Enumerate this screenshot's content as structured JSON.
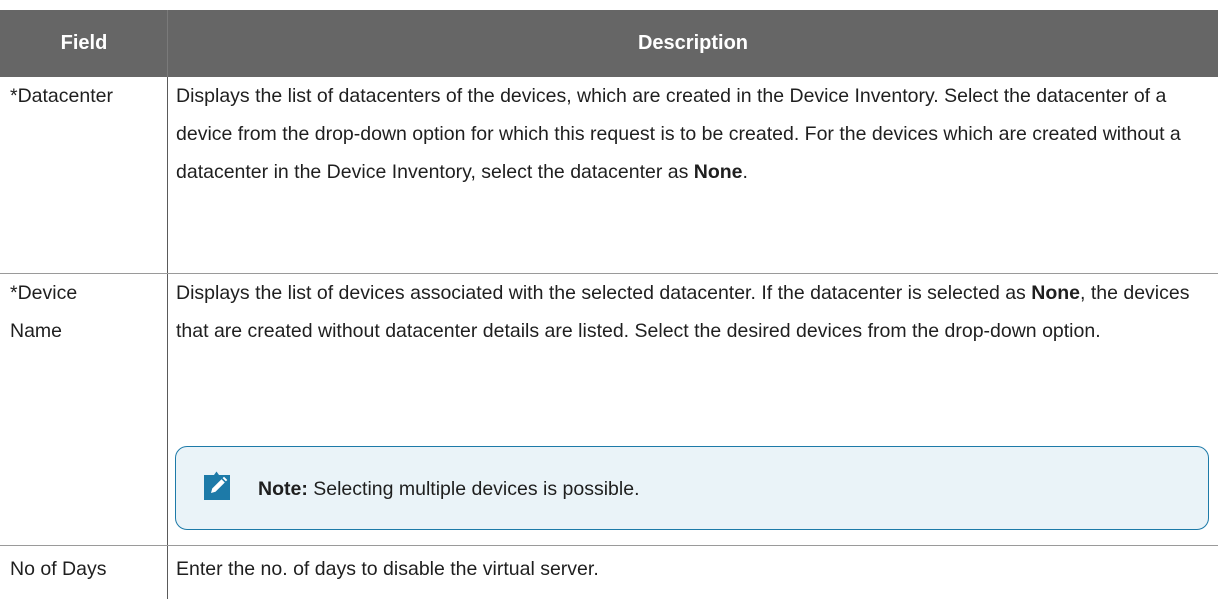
{
  "table": {
    "headers": {
      "field": "Field",
      "description": "Description"
    },
    "rows": [
      {
        "field": "*Datacenter",
        "desc_parts": [
          "Displays the list of datacenters of the devices, which are created in the Device Inventory. Select the datacenter of a device from the drop-down option for which this request is to be created. For the devices which are created without a datacenter in the Device Inventory, select the datacenter as ",
          "None",
          "."
        ]
      },
      {
        "field_line1": "*Device",
        "field_line2": "Name",
        "desc_parts": [
          "Displays the list of devices associated with the selected datacenter. If the datacenter is selected as ",
          "None",
          ", the devices that are created without datacenter details are listed. Select the desired devices from the drop-down option."
        ],
        "note": {
          "label": "Note:",
          "text": " Selecting multiple devices is possible.",
          "icon": "pencil-note-icon",
          "accent_color": "#1d7aa8"
        }
      },
      {
        "field": "No of Days",
        "description": "Enter the no. of days to disable the virtual server."
      }
    ]
  }
}
